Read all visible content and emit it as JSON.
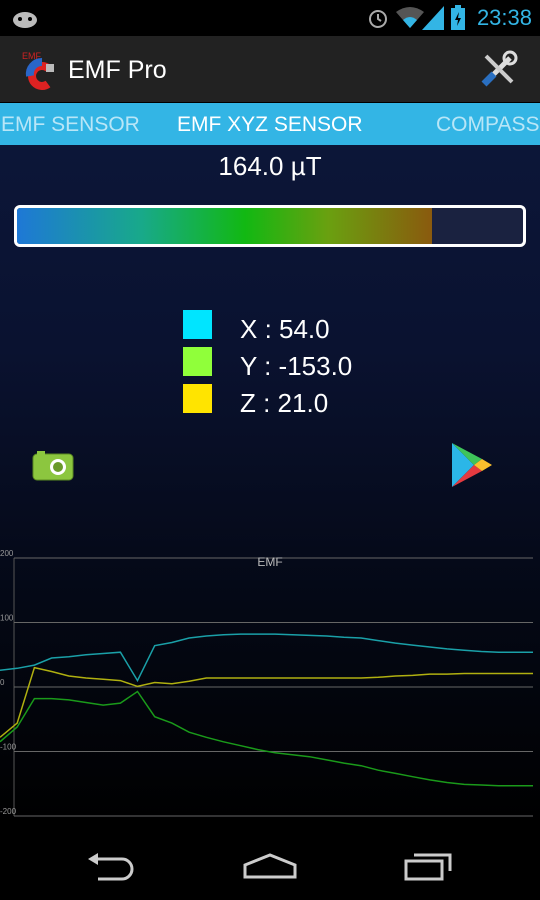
{
  "status_bar": {
    "time": "23:38",
    "icons": [
      "android-icon",
      "alarm-icon",
      "wifi-icon",
      "signal-icon",
      "battery-charging-icon"
    ]
  },
  "action_bar": {
    "title": "EMF Pro",
    "logo": "EMF PRO",
    "settings_icon": "tools-icon"
  },
  "tabs": [
    {
      "label": "EMF SENSOR",
      "selected": false
    },
    {
      "label": "EMF XYZ SENSOR",
      "selected": true
    },
    {
      "label": "COMPASS",
      "selected": false
    }
  ],
  "reading": {
    "text": "164.0  µT",
    "fill_fraction": 0.82
  },
  "legend": [
    {
      "label": "X : 54.0",
      "color": "#00e5ff"
    },
    {
      "label": "Y : -153.0",
      "color": "#90ff3a"
    },
    {
      "label": "Z : 21.0",
      "color": "#ffe400"
    }
  ],
  "buttons": {
    "camera": "camera-icon",
    "play_store": "play-store-icon"
  },
  "chart_data": {
    "type": "line",
    "title": "EMF",
    "ylim": [
      -200,
      200
    ],
    "yticks": [
      "200",
      "100",
      "0",
      "-100",
      "-200"
    ],
    "grid": true,
    "series": [
      {
        "color": "#1aa0a8",
        "values": [
          26,
          29,
          34,
          45,
          47,
          50,
          52,
          54,
          10,
          64,
          69,
          76,
          79,
          81,
          82,
          82,
          82,
          81,
          80,
          79,
          77,
          76,
          72,
          68,
          65,
          62,
          59,
          57,
          55,
          54,
          54,
          54
        ]
      },
      {
        "color": "#1a9a1a",
        "values": [
          -85,
          -62,
          -18,
          -18,
          -20,
          -24,
          -28,
          -25,
          -7,
          -46,
          -56,
          -70,
          -78,
          -85,
          -91,
          -97,
          -102,
          -105,
          -108,
          -113,
          -118,
          -122,
          -129,
          -134,
          -139,
          -144,
          -148,
          -151,
          -152,
          -153,
          -153,
          -153
        ]
      },
      {
        "color": "#b0b010",
        "values": [
          -78,
          -56,
          30,
          24,
          17,
          14,
          12,
          10,
          1,
          7,
          5,
          9,
          14,
          14,
          14,
          14,
          14,
          14,
          14,
          14,
          14,
          14,
          15,
          17,
          18,
          20,
          20,
          21,
          21,
          21,
          21,
          21
        ]
      }
    ]
  },
  "nav": {
    "back": "back-icon",
    "home": "home-icon",
    "recents": "recents-icon"
  }
}
